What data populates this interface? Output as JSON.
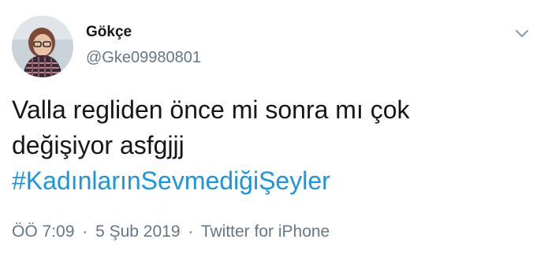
{
  "user": {
    "display_name": "Gökçe",
    "handle": "@Gke09980801"
  },
  "menu": {
    "icon": "chevron-down-icon"
  },
  "tweet": {
    "line1": "Valla regliden önce mi sonra mı çok",
    "line2": "değişiyor asfgjjj",
    "hashtag": "#KadınlarınSevmediğiŞeyler"
  },
  "meta": {
    "time": "ÖÖ 7:09",
    "separator": "·",
    "date": "5 Şub 2019",
    "source": "Twitter for iPhone"
  },
  "colors": {
    "link": "#1b95e0",
    "secondary_text": "#657786",
    "primary_text": "#14171a"
  }
}
